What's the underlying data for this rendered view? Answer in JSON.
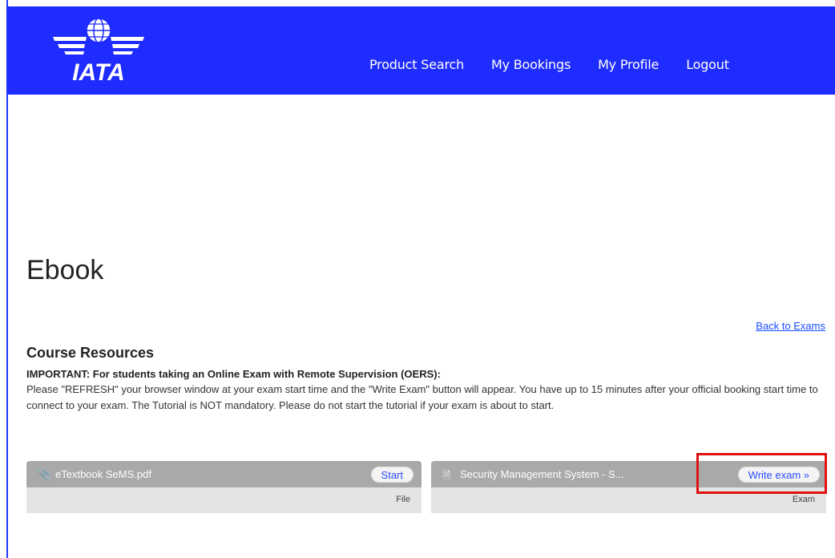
{
  "header": {
    "logo_text": "IATA",
    "nav": [
      "Product Search",
      "My Bookings",
      "My Profile",
      "Logout"
    ]
  },
  "page": {
    "title": "Ebook",
    "back_link": "Back to Exams",
    "section_title": "Course Resources",
    "important": "IMPORTANT: For students taking an Online Exam with Remote Supervision (OERS):",
    "notice": "Please \"REFRESH\" your browser window at your exam start time and the \"Write Exam\" button will appear. You have up to 15 minutes after your official booking start time to connect to your exam. The Tutorial is NOT mandatory. Please do not start the tutorial if your exam is about to start."
  },
  "resources": [
    {
      "name": "eTextbook SeMS.pdf",
      "action": "Start",
      "type": "File",
      "icon": "paperclip-icon"
    },
    {
      "name": "Security Management System - S...",
      "action": "Write exam »",
      "type": "Exam",
      "icon": "document-icon"
    }
  ],
  "colors": {
    "header_bg": "#1f2cff",
    "link": "#1a4dff",
    "highlight": "#e01010"
  }
}
